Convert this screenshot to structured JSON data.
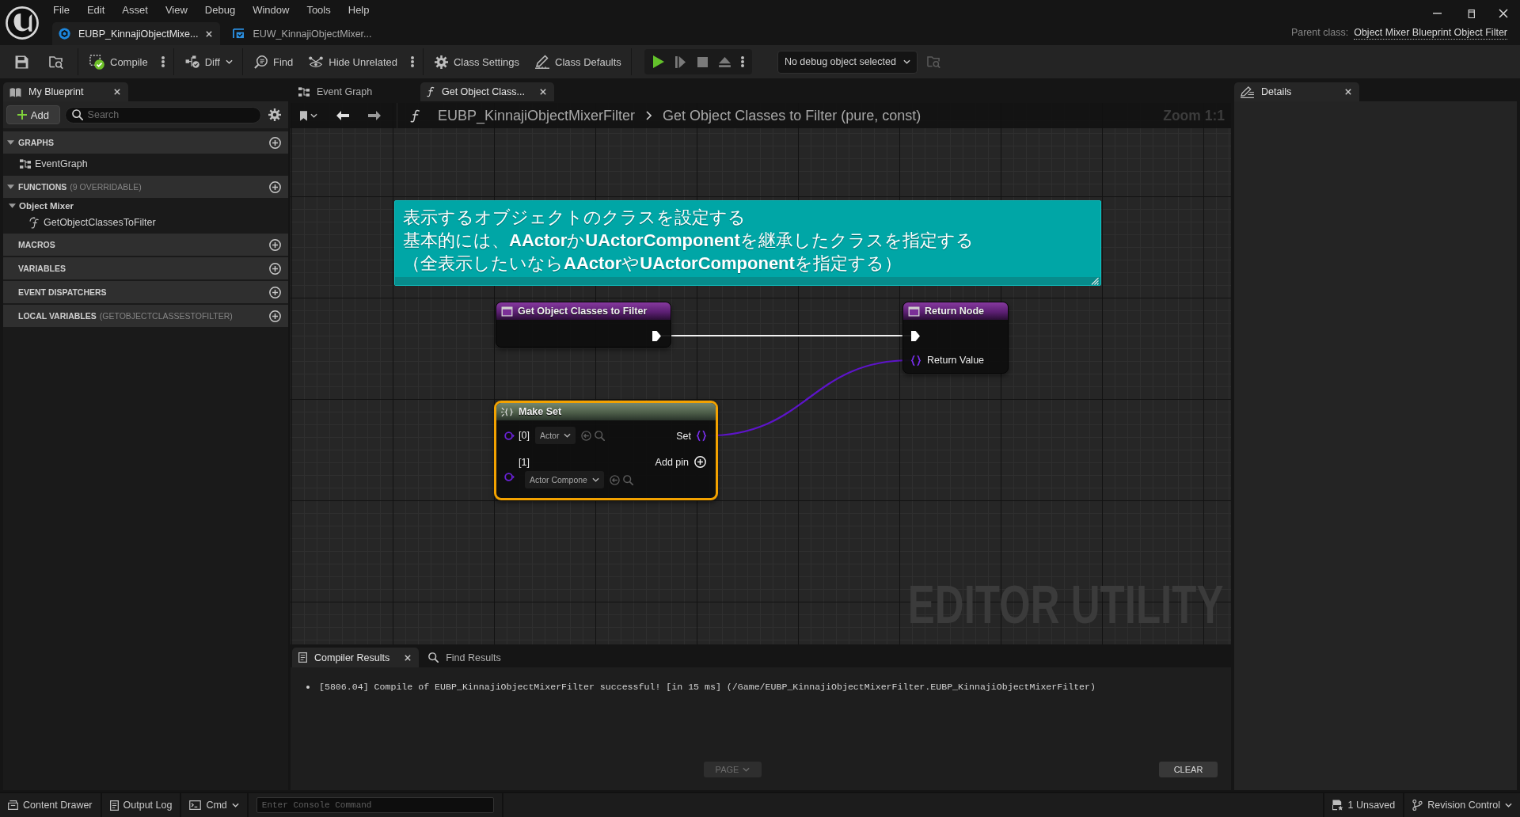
{
  "menu": [
    "File",
    "Edit",
    "Asset",
    "View",
    "Debug",
    "Window",
    "Tools",
    "Help"
  ],
  "document_tabs": [
    {
      "label": "EUBP_KinnajiObjectMixe...",
      "selected": true
    },
    {
      "label": "EUW_KinnajiObjectMixer...",
      "selected": false
    }
  ],
  "parent_class": {
    "label": "Parent class:",
    "value": "Object Mixer Blueprint Object Filter"
  },
  "toolbar": {
    "buttons": [
      {
        "label": "Compile",
        "kind": "options"
      },
      {
        "label": "Diff",
        "kind": "dropdown"
      },
      {
        "label": "Find",
        "kind": "plain"
      },
      {
        "label": "Hide Unrelated",
        "kind": "options"
      },
      {
        "label": "Class Settings",
        "kind": "plain"
      },
      {
        "label": "Class Defaults",
        "kind": "plain"
      }
    ],
    "debug_object": "No debug object selected"
  },
  "my_blueprint": {
    "tab": "My Blueprint",
    "add_button": "Add",
    "search": {
      "placeholder": "Search"
    },
    "sections": [
      {
        "title": "GRAPHS",
        "expanded": true,
        "items": [
          {
            "label": "EventGraph",
            "kind": "graph"
          }
        ]
      },
      {
        "title": "FUNCTIONS",
        "note": "(9 OVERRIDABLE)",
        "expanded": true,
        "categories": [
          {
            "label": "Object Mixer",
            "expanded": true,
            "items": [
              {
                "label": "GetObjectClassesToFilter",
                "kind": "function"
              }
            ]
          }
        ]
      },
      {
        "title": "MACROS"
      },
      {
        "title": "VARIABLES"
      },
      {
        "title": "EVENT DISPATCHERS"
      },
      {
        "title": "LOCAL VARIABLES",
        "note": "(GETOBJECTCLASSESTOFILTER)"
      }
    ]
  },
  "graph": {
    "tabs": [
      {
        "label": "Event Graph",
        "selected": false
      },
      {
        "label": "Get Object Class...",
        "selected": true
      }
    ],
    "breadcrumb": [
      "EUBP_KinnajiObjectMixerFilter",
      "Get Object Classes to Filter (pure, const)"
    ],
    "zoom_label": "Zoom 1:1",
    "comment": {
      "lines": [
        "表示するオブジェクトのクラスを設定する",
        "基本的には、**AActor**か**UActorComponent**を継承したクラスを指定する",
        "（全表示したいなら**AActor**や**UActorComponent**を指定する）"
      ]
    },
    "nodes": [
      {
        "kind": "function-entry",
        "title": "Get Object Classes to Filter",
        "selected": false
      },
      {
        "kind": "function-result",
        "title": "Return Node",
        "selected": false,
        "inputs": [
          {
            "label": "Return Value"
          }
        ]
      },
      {
        "kind": "make-set",
        "title": "Make Set",
        "selected": true,
        "inputs": [
          {
            "label": "[0]",
            "value": "Actor"
          },
          {
            "label": "[1]",
            "value": "Actor Compone"
          }
        ],
        "output": "Set",
        "add_pin": "Add pin"
      }
    ],
    "corner_label": "EDITOR UTILITY"
  },
  "details": {
    "tab": "Details"
  },
  "output_panel": {
    "tabs": [
      {
        "label": "Compiler Results",
        "selected": true
      },
      {
        "label": "Find Results",
        "selected": false
      }
    ],
    "log": [
      "[5806.04] Compile of EUBP_KinnajiObjectMixerFilter successful! [in 15 ms] (/Game/EUBP_KinnajiObjectMixerFilter.EUBP_KinnajiObjectMixerFilter)"
    ],
    "page_button": {
      "label": "PAGE",
      "disabled": true
    },
    "clear_button": {
      "label": "CLEAR"
    }
  },
  "status_bar": {
    "left": [
      {
        "label": "Content Drawer",
        "kind": "plain"
      },
      {
        "label": "Output Log",
        "kind": "plain"
      },
      {
        "label": "Cmd",
        "kind": "dropdown"
      }
    ],
    "console": {
      "placeholder": "Enter Console Command"
    },
    "right": [
      {
        "label": "1 Unsaved",
        "kind": "plain"
      },
      {
        "label": "Revision Control",
        "kind": "dropdown"
      }
    ]
  }
}
